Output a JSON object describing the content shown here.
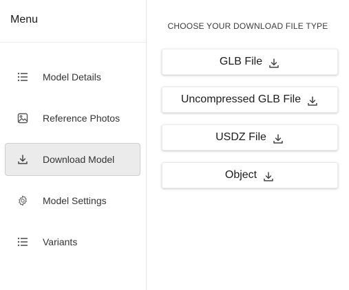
{
  "sidebar": {
    "title": "Menu",
    "items": [
      {
        "label": "Model Details",
        "icon": "list-icon",
        "active": false
      },
      {
        "label": "Reference Photos",
        "icon": "image-icon",
        "active": false
      },
      {
        "label": "Download Model",
        "icon": "download-icon",
        "active": true
      },
      {
        "label": "Model Settings",
        "icon": "gear-icon",
        "active": false
      },
      {
        "label": "Variants",
        "icon": "list-icon",
        "active": false
      }
    ]
  },
  "main": {
    "heading": "CHOOSE YOUR DOWNLOAD FILE TYPE",
    "buttons": [
      {
        "label": "GLB File",
        "icon": "download-icon"
      },
      {
        "label": "Uncompressed GLB File",
        "icon": "download-icon"
      },
      {
        "label": "USDZ File",
        "icon": "download-icon"
      },
      {
        "label": "Object",
        "icon": "download-icon"
      }
    ]
  },
  "colors": {
    "active_bg": "#ebebeb",
    "active_border": "#cfcfcf",
    "divider": "#e6e6e6",
    "icon": "#555555"
  }
}
